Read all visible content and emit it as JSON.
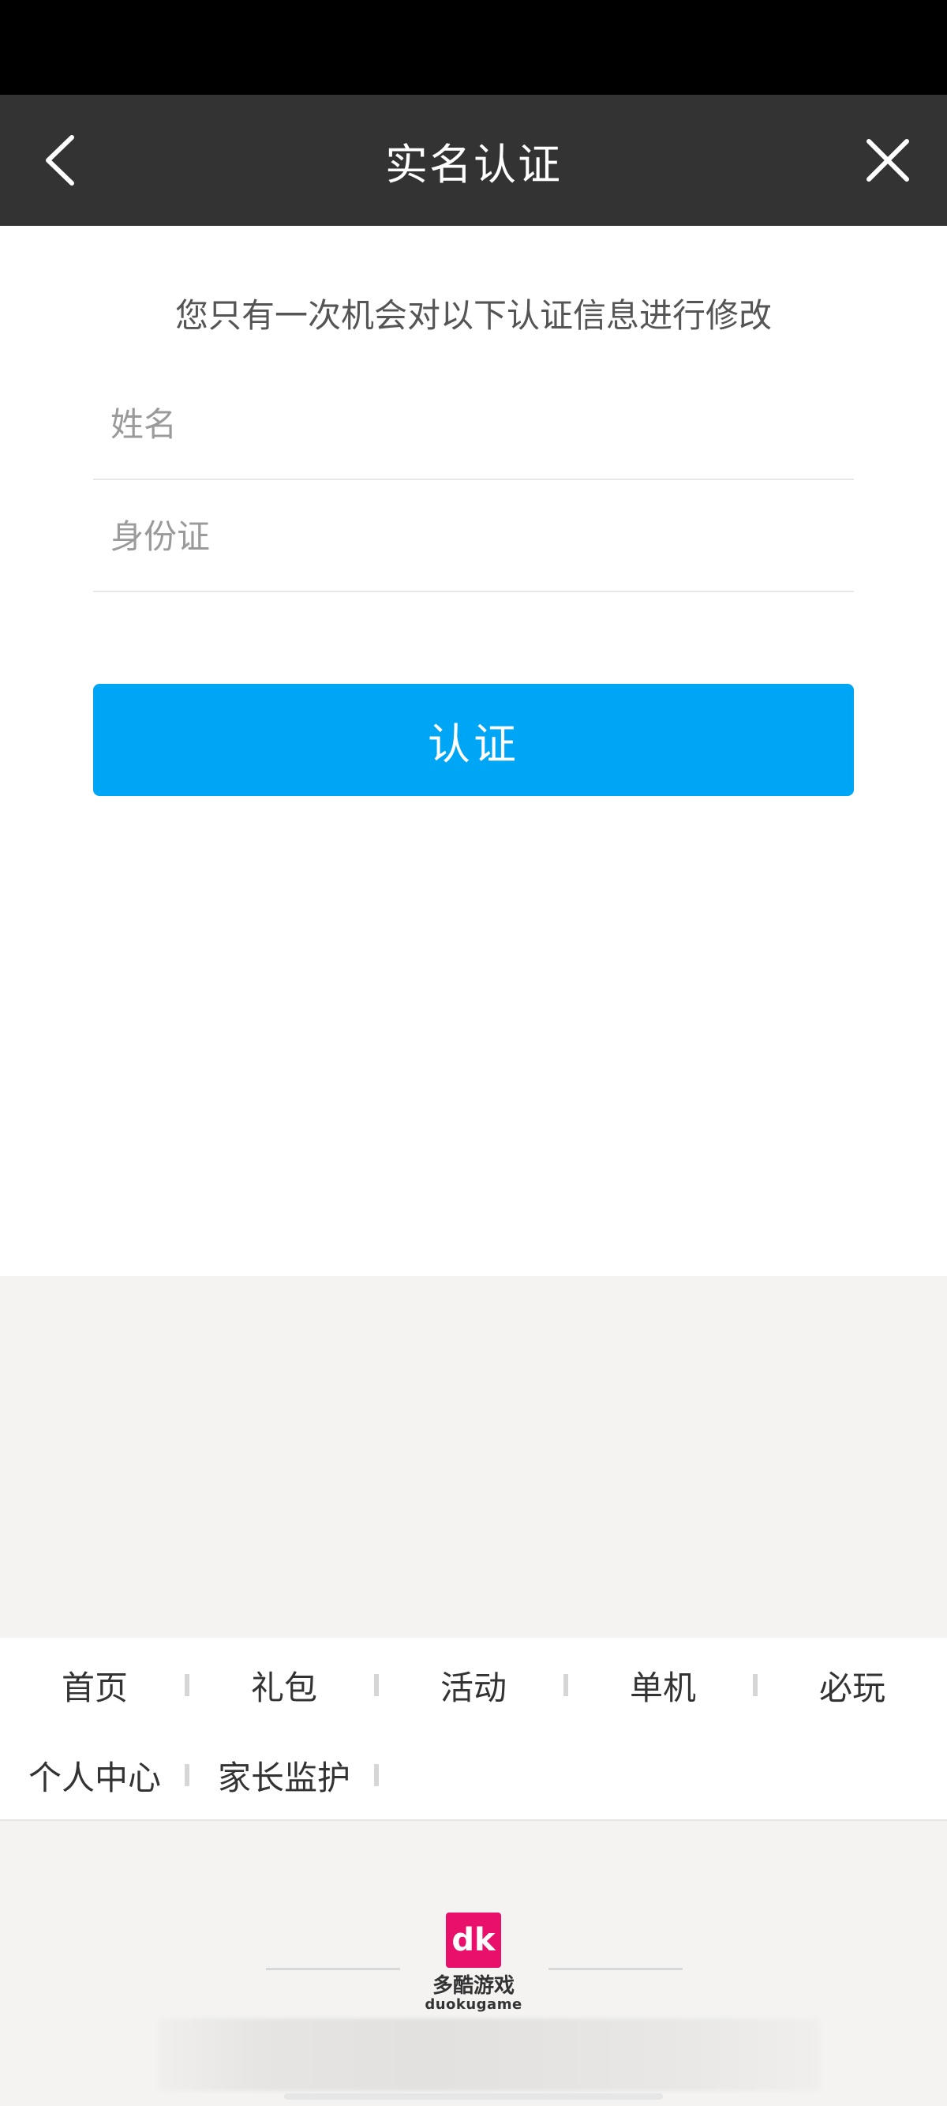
{
  "header": {
    "title": "实名认证",
    "back_icon": "chevron-left-icon",
    "close_icon": "close-icon"
  },
  "form": {
    "notice": "您只有一次机会对以下认证信息进行修改",
    "name_field": {
      "placeholder": "姓名",
      "value": ""
    },
    "id_field": {
      "placeholder": "身份证",
      "value": ""
    },
    "submit_label": "认证"
  },
  "footer_links": {
    "row1": [
      "首页",
      "礼包",
      "活动",
      "单机",
      "必玩"
    ],
    "row2": [
      "个人中心",
      "家长监护"
    ]
  },
  "brand": {
    "logo_mark": "dk",
    "name_cn": "多酷游戏",
    "name_en": "duokugame"
  },
  "colors": {
    "header_bg": "#333333",
    "primary_button": "#00a6f6",
    "logo_pink": "#e8106a"
  }
}
